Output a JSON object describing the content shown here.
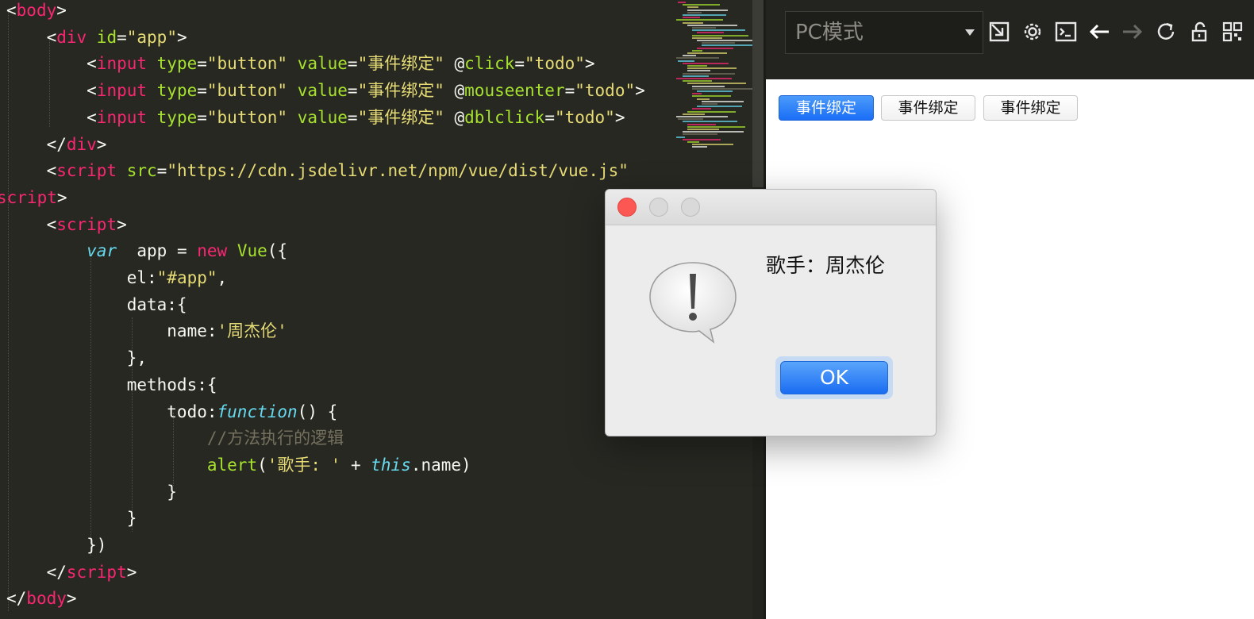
{
  "editor": {
    "lines": [
      [
        {
          "t": "<",
          "c": "t-punc"
        },
        {
          "t": "body",
          "c": "t-tag"
        },
        {
          "t": ">",
          "c": "t-punc"
        }
      ],
      [
        {
          "t": "    <",
          "c": "t-punc"
        },
        {
          "t": "div",
          "c": "t-tag"
        },
        {
          "t": " id",
          "c": "t-attr"
        },
        {
          "t": "=",
          "c": "t-punc"
        },
        {
          "t": "\"app\"",
          "c": "t-str"
        },
        {
          "t": ">",
          "c": "t-punc"
        }
      ],
      [
        {
          "t": "        <",
          "c": "t-punc"
        },
        {
          "t": "input",
          "c": "t-tag"
        },
        {
          "t": " type",
          "c": "t-attr"
        },
        {
          "t": "=",
          "c": "t-punc"
        },
        {
          "t": "\"button\"",
          "c": "t-str"
        },
        {
          "t": " value",
          "c": "t-attr"
        },
        {
          "t": "=",
          "c": "t-punc"
        },
        {
          "t": "\"事件绑定\"",
          "c": "t-str"
        },
        {
          "t": " @",
          "c": "t-punc"
        },
        {
          "t": "click",
          "c": "t-attr"
        },
        {
          "t": "=",
          "c": "t-punc"
        },
        {
          "t": "\"todo\"",
          "c": "t-str"
        },
        {
          "t": ">",
          "c": "t-punc"
        }
      ],
      [
        {
          "t": "        <",
          "c": "t-punc"
        },
        {
          "t": "input",
          "c": "t-tag"
        },
        {
          "t": " type",
          "c": "t-attr"
        },
        {
          "t": "=",
          "c": "t-punc"
        },
        {
          "t": "\"button\"",
          "c": "t-str"
        },
        {
          "t": " value",
          "c": "t-attr"
        },
        {
          "t": "=",
          "c": "t-punc"
        },
        {
          "t": "\"事件绑定\"",
          "c": "t-str"
        },
        {
          "t": " @",
          "c": "t-punc"
        },
        {
          "t": "mouseenter",
          "c": "t-attr"
        },
        {
          "t": "=",
          "c": "t-punc"
        },
        {
          "t": "\"todo\"",
          "c": "t-str"
        },
        {
          "t": ">",
          "c": "t-punc"
        }
      ],
      [
        {
          "t": "        <",
          "c": "t-punc"
        },
        {
          "t": "input",
          "c": "t-tag"
        },
        {
          "t": " type",
          "c": "t-attr"
        },
        {
          "t": "=",
          "c": "t-punc"
        },
        {
          "t": "\"button\"",
          "c": "t-str"
        },
        {
          "t": " value",
          "c": "t-attr"
        },
        {
          "t": "=",
          "c": "t-punc"
        },
        {
          "t": "\"事件绑定\"",
          "c": "t-str"
        },
        {
          "t": " @",
          "c": "t-punc"
        },
        {
          "t": "dblclick",
          "c": "t-attr"
        },
        {
          "t": "=",
          "c": "t-punc"
        },
        {
          "t": "\"todo\"",
          "c": "t-str"
        },
        {
          "t": ">",
          "c": "t-punc"
        }
      ],
      [
        {
          "t": "    </",
          "c": "t-punc"
        },
        {
          "t": "div",
          "c": "t-tag"
        },
        {
          "t": ">",
          "c": "t-punc"
        }
      ],
      [
        {
          "t": "    <",
          "c": "t-punc"
        },
        {
          "t": "script",
          "c": "t-tag"
        },
        {
          "t": " src",
          "c": "t-attr"
        },
        {
          "t": "=",
          "c": "t-punc"
        },
        {
          "t": "\"https://cdn.jsdelivr.net/npm/vue/dist/vue.js\"",
          "c": "t-str"
        }
      ],
      [
        {
          "t": "script",
          "c": "t-tag"
        },
        {
          "t": ">",
          "c": "t-punc"
        }
      ],
      [
        {
          "t": "    <",
          "c": "t-punc"
        },
        {
          "t": "script",
          "c": "t-tag"
        },
        {
          "t": ">",
          "c": "t-punc"
        }
      ],
      [
        {
          "t": "        ",
          "c": "t-punc"
        },
        {
          "t": "var",
          "c": "t-kw"
        },
        {
          "t": "  app = ",
          "c": "t-punc"
        },
        {
          "t": "new",
          "c": "t-new"
        },
        {
          "t": " ",
          "c": "t-punc"
        },
        {
          "t": "Vue",
          "c": "t-cls"
        },
        {
          "t": "({",
          "c": "t-punc"
        }
      ],
      [
        {
          "t": "            el:",
          "c": "t-punc"
        },
        {
          "t": "\"#app\"",
          "c": "t-str"
        },
        {
          "t": ",",
          "c": "t-punc"
        }
      ],
      [
        {
          "t": "            data:{",
          "c": "t-punc"
        }
      ],
      [
        {
          "t": "                name:",
          "c": "t-punc"
        },
        {
          "t": "'周杰伦'",
          "c": "t-str"
        }
      ],
      [
        {
          "t": "            },",
          "c": "t-punc"
        }
      ],
      [
        {
          "t": "            methods:{",
          "c": "t-punc"
        }
      ],
      [
        {
          "t": "                todo:",
          "c": "t-punc"
        },
        {
          "t": "function",
          "c": "t-kw"
        },
        {
          "t": "() {",
          "c": "t-punc"
        }
      ],
      [
        {
          "t": "                    ",
          "c": "t-punc"
        },
        {
          "t": "//方法执行的逻辑",
          "c": "t-cmt"
        }
      ],
      [
        {
          "t": "                    ",
          "c": "t-punc"
        },
        {
          "t": "alert",
          "c": "t-fn"
        },
        {
          "t": "(",
          "c": "t-punc"
        },
        {
          "t": "'歌手: '",
          "c": "t-str"
        },
        {
          "t": " + ",
          "c": "t-punc"
        },
        {
          "t": "this",
          "c": "t-kw"
        },
        {
          "t": ".name)",
          "c": "t-punc"
        }
      ],
      [
        {
          "t": "                }",
          "c": "t-punc"
        }
      ],
      [
        {
          "t": "            }",
          "c": "t-punc"
        }
      ],
      [
        {
          "t": "        })",
          "c": "t-punc"
        }
      ],
      [
        {
          "t": "    </",
          "c": "t-punc"
        },
        {
          "t": "script",
          "c": "t-tag"
        },
        {
          "t": ">",
          "c": "t-punc"
        }
      ],
      [
        {
          "t": "</",
          "c": "t-punc"
        },
        {
          "t": "body",
          "c": "t-tag"
        },
        {
          "t": ">",
          "c": "t-punc"
        }
      ]
    ]
  },
  "toolbar": {
    "mode_select_value": "PC模式",
    "icons": [
      "resize-icon",
      "gear-icon",
      "terminal-icon",
      "back-arrow-icon",
      "forward-arrow-icon",
      "refresh-icon",
      "unlock-icon",
      "qr-code-icon"
    ]
  },
  "preview": {
    "buttons": [
      "事件绑定",
      "事件绑定",
      "事件绑定"
    ]
  },
  "dialog": {
    "message": "歌手：周杰伦",
    "ok_label": "OK"
  },
  "colors": {
    "editor_bg": "#272822",
    "tag": "#f92672",
    "attr": "#a6e22e",
    "string": "#e6db74",
    "keyword": "#66d9ef",
    "comment": "#75715e",
    "ok_button": "#1a6cf2"
  }
}
